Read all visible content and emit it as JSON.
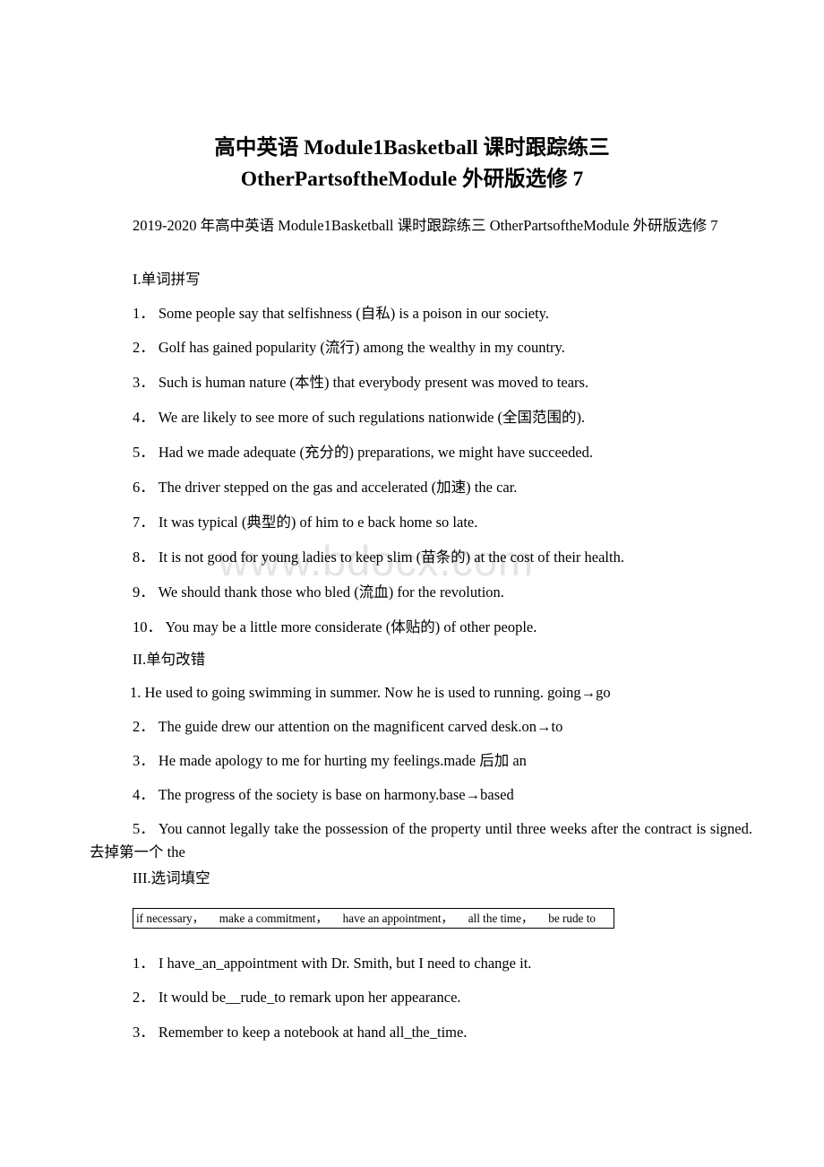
{
  "document": {
    "title_line1": "高中英语 Module1Basketball 课时跟踪练三",
    "title_line2": "OtherPartsoftheModule 外研版选修 7",
    "subtitle": "2019-2020 年高中英语 Module1Basketball 课时跟踪练三 OtherPartsoftheModule 外研版选修 7",
    "watermark": "www.bdocx.com",
    "watermark_color": "#e6e3e3",
    "text_color": "#000000",
    "page_background": "#ffffff"
  },
  "sections": [
    {
      "id": "section-1",
      "heading": "I.单词拼写",
      "items": [
        {
          "num": "1．",
          "text": "Some people say that selfishness (自私) is a poison in our society."
        },
        {
          "num": "2．",
          "text": "Golf has gained popularity (流行) among the wealthy in my country."
        },
        {
          "num": "3．",
          "text": "Such is human nature (本性) that everybody present was moved to tears."
        },
        {
          "num": "4．",
          "text": "We are likely to see more of such regulations nationwide (全国范围的)."
        },
        {
          "num": "5．",
          "text": "Had we made adequate (充分的) preparations, we might have succeeded."
        },
        {
          "num": "6．",
          "text": "The driver stepped on the gas and accelerated (加速) the car."
        },
        {
          "num": "7．",
          "text": "It was typical (典型的) of him to e back home so late."
        },
        {
          "num": "8．",
          "text": "It is not good for young ladies to keep slim (苗条的) at the cost of their health."
        },
        {
          "num": "9．",
          "text": "We should thank those who bled (流血) for the revolution."
        },
        {
          "num": "10．",
          "text": "You may be a little more considerate (体贴的) of other people."
        }
      ]
    },
    {
      "id": "section-2",
      "heading": "II.单句改错",
      "items": [
        {
          "num": "1.",
          "text": "He used to going swimming in summer. Now he is used to running. going→go"
        },
        {
          "num": "2．",
          "text": "The guide drew our attention on the magnificent carved desk.on→to"
        },
        {
          "num": "3．",
          "text": "He made apology to me for hurting my feelings.made 后加 an"
        },
        {
          "num": "4．",
          "text": "The progress of the society is base on harmony.base→based"
        },
        {
          "num": "5．",
          "text": "You cannot legally take the possession of the property until three weeks after the contract is signed. 去掉第一个 the"
        }
      ]
    },
    {
      "id": "section-3",
      "heading": "III.选词填空",
      "word_bank": [
        "if necessary",
        "make a commitment",
        "have an appointment",
        "all the time",
        "be rude to"
      ],
      "word_bank_separator": "，",
      "items": [
        {
          "num": "1．",
          "text": "I have_an_appointment with Dr. Smith, but I need to change it."
        },
        {
          "num": "2．",
          "text": "It would be__rude_to remark upon her appearance."
        },
        {
          "num": "3．",
          "text": "Remember to keep a notebook at hand all_the_time."
        }
      ]
    }
  ]
}
